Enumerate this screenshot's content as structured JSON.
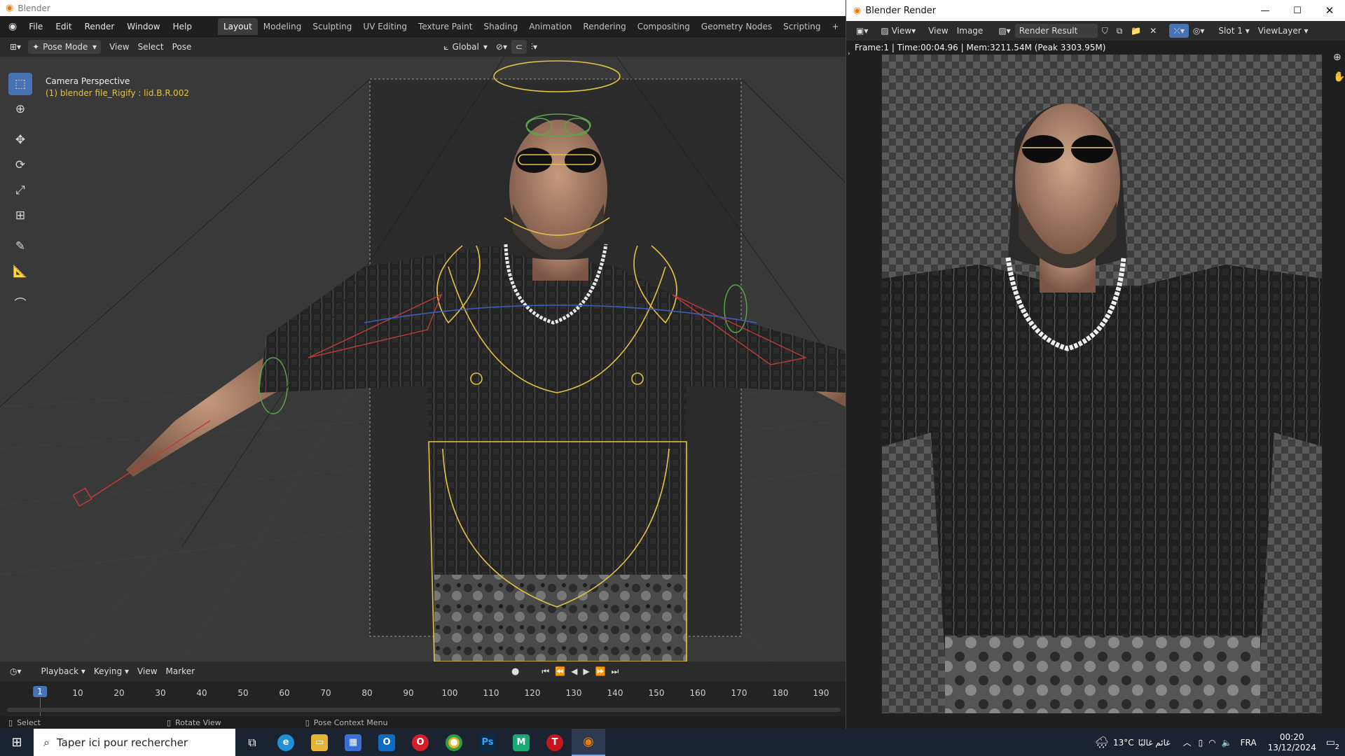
{
  "app_title": "Blender",
  "menus": [
    "File",
    "Edit",
    "Render",
    "Window",
    "Help"
  ],
  "workspaces": [
    "Layout",
    "Modeling",
    "Sculpting",
    "UV Editing",
    "Texture Paint",
    "Shading",
    "Animation",
    "Rendering",
    "Compositing",
    "Geometry Nodes",
    "Scripting",
    "+"
  ],
  "active_workspace": "Layout",
  "viewport_header": {
    "mode": "Pose Mode",
    "menus": [
      "View",
      "Select",
      "Pose"
    ],
    "orientation": "Global"
  },
  "viewport": {
    "camera_label": "Camera Perspective",
    "object_label": "(1) blender file_Rigify : lid.B.R.002"
  },
  "tools": [
    "select-box",
    "cursor",
    "move",
    "rotate",
    "scale",
    "transform",
    "annotate",
    "measure",
    "pose-relax"
  ],
  "timeline": {
    "menus": [
      "Playback",
      "Keying",
      "View",
      "Marker"
    ],
    "current_frame": "1",
    "frames": [
      "10",
      "20",
      "30",
      "40",
      "50",
      "60",
      "70",
      "80",
      "90",
      "100",
      "110",
      "120",
      "130",
      "140",
      "150",
      "160",
      "170",
      "180",
      "190"
    ]
  },
  "status_bar": {
    "select": "Select",
    "rotate": "Rotate View",
    "context": "Pose Context Menu"
  },
  "render_window": {
    "title": "Blender Render",
    "menus": [
      "View",
      "View",
      "Image"
    ],
    "image_name": "Render Result",
    "slot": "Slot 1",
    "view_layer": "ViewLayer",
    "info": "Frame:1 | Time:00:04.96 | Mem:3211.54M (Peak 3303.95M)"
  },
  "taskbar": {
    "search_placeholder": "Taper ici pour rechercher",
    "weather": "13°C",
    "weather_text": "غائم غالبًا",
    "language": "FRA",
    "time": "00:20",
    "date": "13/12/2024",
    "notifications": "2"
  },
  "colors": {
    "accent": "#4772b3",
    "rig_yellow": "#e3c342",
    "rig_green": "#5aa84a",
    "rig_red": "#c23a3a"
  }
}
